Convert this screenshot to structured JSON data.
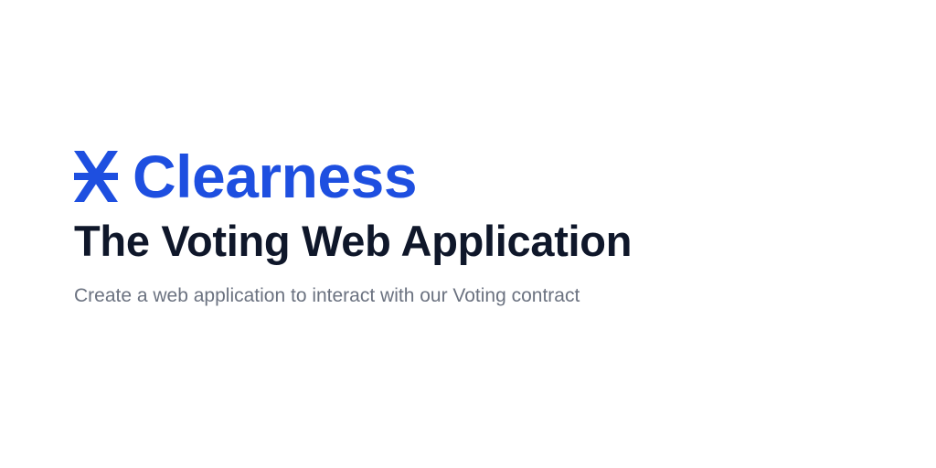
{
  "brand": {
    "name": "Clearness",
    "icon": "x-cross-icon"
  },
  "hero": {
    "title": "The Voting Web Application",
    "subtitle": "Create a web application to interact with our Voting contract"
  },
  "colors": {
    "accent": "#1e4fe0",
    "title": "#0f172a",
    "subtitle": "#6b7280",
    "background": "#ffffff"
  }
}
